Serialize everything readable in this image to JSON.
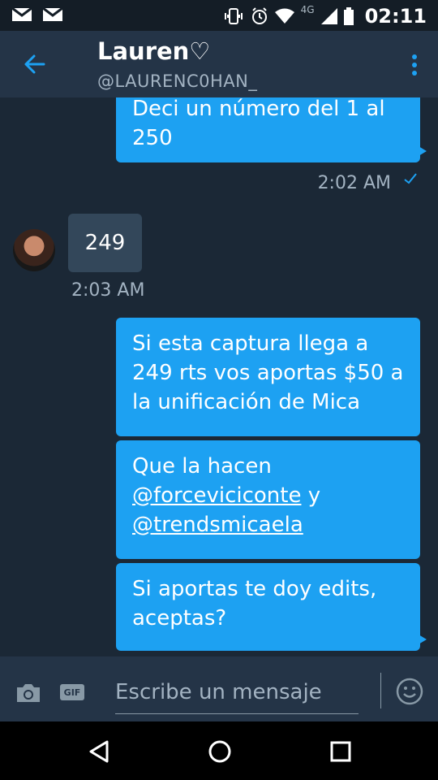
{
  "status_bar": {
    "network": "4G",
    "time": "02:11"
  },
  "header": {
    "name": "Lauren♡",
    "handle": "@LAURENC0HAN_"
  },
  "messages": [
    {
      "from": "me",
      "lines": [
        "Deci un número del 1 al",
        "250"
      ]
    },
    {
      "from": "me",
      "meta": true,
      "time": "2:02 AM"
    },
    {
      "from": "them",
      "text": "249",
      "time": "2:03 AM"
    },
    {
      "from": "me",
      "lines": [
        "Si esta captura llega a",
        "249 rts vos aportas $50 a",
        "la unificación de Mica"
      ]
    },
    {
      "from": "me",
      "line1": "Que la hacen",
      "mention1": "@forceviciconte",
      "after_mention1": " y",
      "mention2": "@trendsmicaela"
    },
    {
      "from": "me",
      "lines": [
        "Si aportas te doy edits,",
        "aceptas?"
      ]
    }
  ],
  "composer": {
    "placeholder": "Escribe un mensaje",
    "gif_label": "GIF"
  },
  "colors": {
    "bubble_out": "#1da1f2",
    "bubble_in": "#33475a",
    "background": "#1b2836",
    "header": "#243447"
  }
}
